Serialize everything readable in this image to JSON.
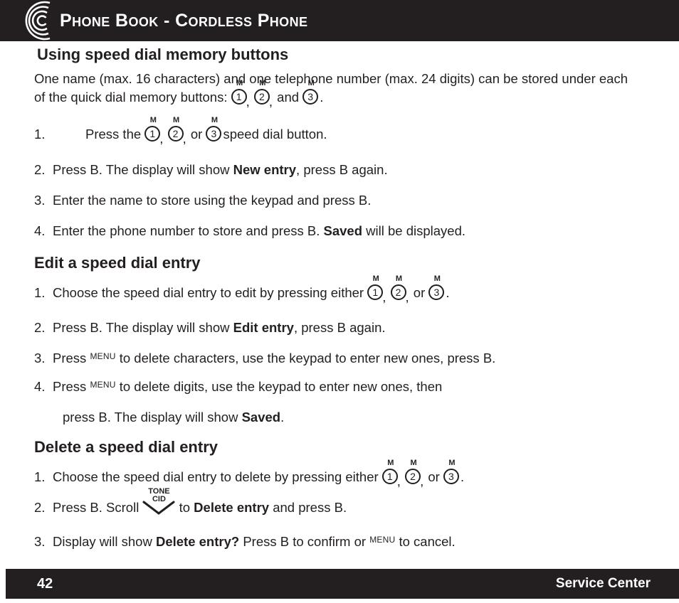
{
  "header": {
    "title": "Phone Book - Cordless Phone",
    "logo_icon": "concentric-circles-logo"
  },
  "sections": {
    "heading1": "Using speed dial memory buttons",
    "heading2": "Edit a speed dial entry",
    "heading3": "Delete a speed dial entry"
  },
  "intro": {
    "part1": "One name (max. 16 characters) and one telephone number (max. 24 digits) can be stored under each of the quick dial memory buttons:",
    "and": "and",
    "period": "."
  },
  "keys": {
    "m_label": "M",
    "m1": "1",
    "m2": "2",
    "m3": "3",
    "comma": ",",
    "menu": "MENU",
    "tone": "TONE",
    "cid": "CID"
  },
  "list1": [
    {
      "num": "1.",
      "before": "Press the",
      "after": "speed dial button."
    },
    {
      "num": "2.",
      "before": "Press B. The display will show",
      "bold": "New entry",
      "after": ", press B again."
    },
    {
      "num": "3.",
      "before": "Enter the name to store using the keypad and press B."
    },
    {
      "num": "4.",
      "before": "Enter the phone number to store and press B.",
      "bold": "Saved",
      "after": "will be displayed."
    }
  ],
  "list2": [
    {
      "num": "1.",
      "before": "Choose the speed dial entry to edit by pressing either",
      "or": "or",
      "after": "."
    },
    {
      "num": "2.",
      "before": "Press B. The display will show",
      "bold": "Edit entry",
      "after": ", press B again."
    },
    {
      "num": "3.",
      "before": "Press",
      "after": "to delete characters, use the keypad to enter new ones, press B."
    },
    {
      "num": "4.",
      "before": "Press",
      "after": "to delete digits, use the keypad to enter new ones, then",
      "continued_before": "press B. The display will show",
      "continued_bold": "Saved",
      "continued_after": "."
    }
  ],
  "list3": [
    {
      "num": "1.",
      "before": "Choose the speed dial entry to delete by pressing either",
      "or": "or",
      "after": "."
    },
    {
      "num": "2.",
      "before": "Press B. Scroll",
      "middle": "to",
      "bold": "Delete entry",
      "after": "and press B."
    },
    {
      "num": "3.",
      "before": "Display will show",
      "bold": "Delete entry?",
      "middle": "Press B to confirm or",
      "after": "to cancel."
    }
  ],
  "footer": {
    "page": "42",
    "label": "Service Center"
  },
  "colors": {
    "bar": "#231f20",
    "text": "#231f20",
    "bar_text": "#ffffff",
    "page_bg": "#ffffff"
  }
}
